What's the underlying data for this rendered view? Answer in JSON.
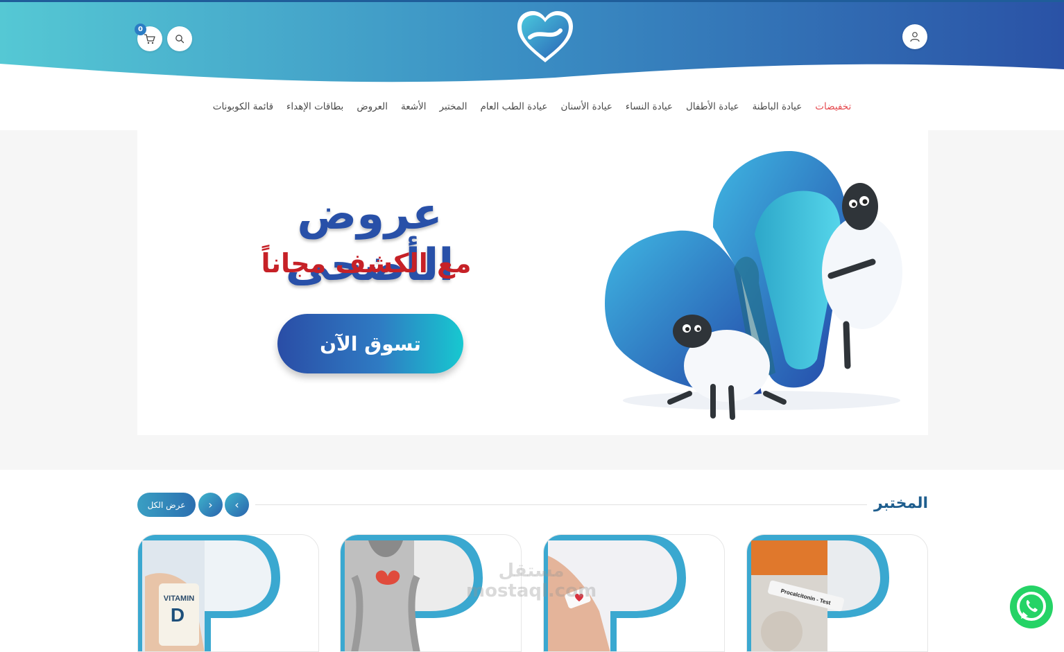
{
  "header": {
    "logo_name": "heart-logo",
    "cart_count": "0",
    "colors": {
      "gradient_start": "#52c6d6",
      "gradient_end": "#2a55a8",
      "top_line": "#1f5d9a"
    }
  },
  "nav": {
    "items": [
      {
        "label": "تخفيضات",
        "active": true
      },
      {
        "label": "عيادة الباطنة"
      },
      {
        "label": "عيادة الأطفال"
      },
      {
        "label": "عيادة النساء"
      },
      {
        "label": "عيادة الأسنان"
      },
      {
        "label": "عيادة الطب العام"
      },
      {
        "label": "المختبر"
      },
      {
        "label": "الأشعة"
      },
      {
        "label": "العروض"
      },
      {
        "label": "بطاقات الإهداء"
      },
      {
        "label": "قائمة الكوبونات"
      }
    ],
    "active_color": "#e5484d"
  },
  "hero": {
    "title": "عروض الأضحى",
    "subtitle": "مع الكشف مجاناً",
    "cta": "تسوق الآن"
  },
  "lab_section": {
    "title": "المختبر",
    "view_all": "عرض الكل",
    "prev_symbol": "‹",
    "next_symbol": "›",
    "cards": [
      {
        "image": "procalcitonin-test-tube",
        "image_text": "Procalcitonin - Test"
      },
      {
        "image": "arm-blood-test",
        "image_text": ""
      },
      {
        "image": "thyroid-neck",
        "image_text": ""
      },
      {
        "image": "vitamin-d-bottle",
        "image_text": "VITAMIN D"
      }
    ]
  },
  "watermark": {
    "line1": "مستقل",
    "line2": "mostaql.com"
  },
  "whatsapp": {
    "color": "#25d366"
  }
}
